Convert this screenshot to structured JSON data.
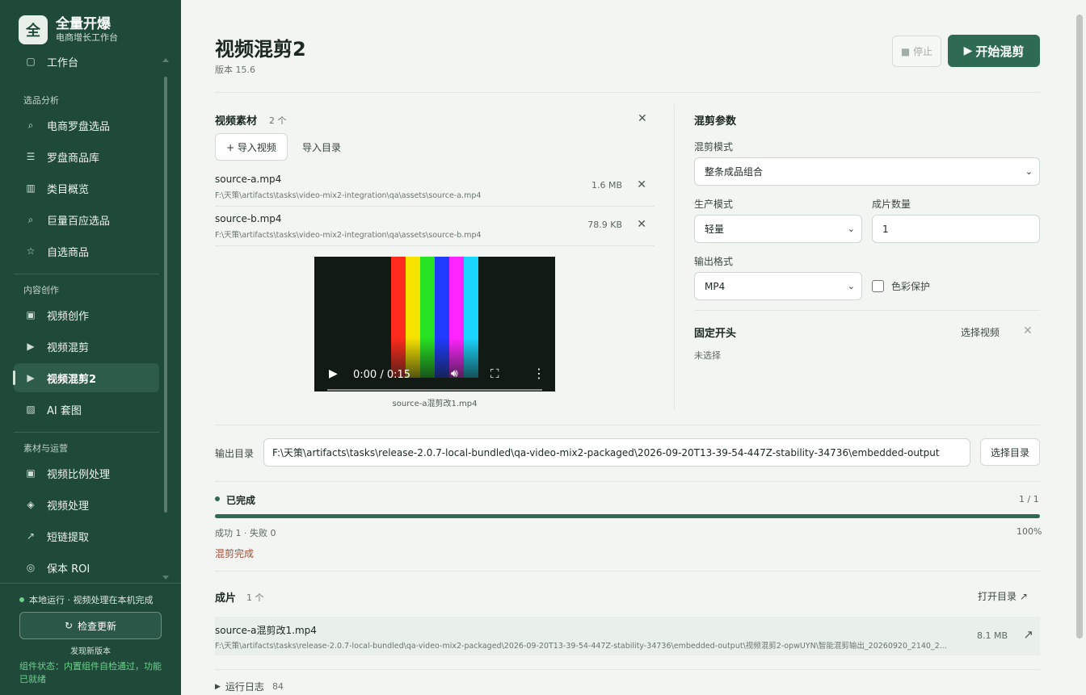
{
  "sidebar": {
    "brand": {
      "logo": "全",
      "title": "全量开爆",
      "subtitle": "电商增长工作台"
    },
    "items": [
      {
        "label": "工作台",
        "icon": "home-icon"
      },
      {
        "section": "选品分析"
      },
      {
        "label": "电商罗盘选品",
        "icon": "search-icon"
      },
      {
        "label": "罗盘商品库",
        "icon": "list-icon"
      },
      {
        "label": "类目概览",
        "icon": "grid-icon"
      },
      {
        "label": "巨量百应选品",
        "icon": "search-icon"
      },
      {
        "label": "自选商品",
        "icon": "star-icon"
      },
      {
        "section": "内容创作"
      },
      {
        "label": "视频创作",
        "icon": "video-box-icon"
      },
      {
        "label": "视频混剪",
        "icon": "play-icon"
      },
      {
        "label": "视频混剪2",
        "icon": "play-icon",
        "active": true
      },
      {
        "label": "AI 套图",
        "icon": "hatch-icon"
      },
      {
        "section": "素材与运营"
      },
      {
        "label": "视频比例处理",
        "icon": "video-box-icon"
      },
      {
        "label": "视频处理",
        "icon": "diamond-icon"
      },
      {
        "label": "短链提取",
        "icon": "arrow-link-icon"
      },
      {
        "label": "保本 ROI",
        "icon": "target-icon"
      }
    ],
    "sections": {
      "analysis": "选品分析",
      "content": "内容创作",
      "ops": "素材与运营"
    },
    "status": "本地运行 · 视频处理在本机完成",
    "update_button": "检查更新",
    "new_version": "发现新版本",
    "component_status": "组件状态：内置组件自检通过，功能已就绪"
  },
  "header": {
    "title": "视频混剪2",
    "version": "版本 15.6",
    "stop_label": "■ 停止",
    "start_label": "开始混剪"
  },
  "materials": {
    "title": "视频素材",
    "count": "2 个",
    "import_video": "+ 导入视频",
    "import_dir": "导入目录",
    "files": [
      {
        "name": "source-a.mp4",
        "path": "F:\\天策\\artifacts\\tasks\\video-mix2-integration\\qa\\assets\\source-a.mp4",
        "size": "1.6 MB"
      },
      {
        "name": "source-b.mp4",
        "path": "F:\\天策\\artifacts\\tasks\\video-mix2-integration\\qa\\assets\\source-b.mp4",
        "size": "78.9 KB"
      }
    ],
    "preview": {
      "time": "0:00 / 0:15",
      "caption": "source-a混剪改1.mp4",
      "bar_colors": [
        "#ff2b1c",
        "#f7e300",
        "#27e322",
        "#1f3cff",
        "#ff24ff",
        "#1ad6ff"
      ]
    }
  },
  "params": {
    "title": "混剪参数",
    "mode_label": "混剪模式",
    "mode_value": "整条成品组合",
    "production_label": "生产模式",
    "production_value": "轻量",
    "quantity_label": "成片数量",
    "quantity_value": "1",
    "format_label": "输出格式",
    "format_value": "MP4",
    "color_protect": "色彩保护",
    "fixed_intro_title": "固定开头",
    "fixed_intro_select": "选择视频",
    "fixed_intro_status": "未选择"
  },
  "output": {
    "label": "输出目录",
    "path": "F:\\天策\\artifacts\\tasks\\release-2.0.7-local-bundled\\qa-video-mix2-packaged\\2026-09-20T13-39-54-447Z-stability-34736\\embedded-output",
    "choose": "选择目录"
  },
  "progress": {
    "status": "已完成",
    "fraction": "1 / 1",
    "value": 1.0,
    "summary": "成功 1 · 失败 0",
    "percent": "100%",
    "message": "混剪完成"
  },
  "results": {
    "title": "成片",
    "count": "1 个",
    "open_dir": "打开目录 ↗",
    "items": [
      {
        "name": "source-a混剪改1.mp4",
        "path": "F:\\天策\\artifacts\\tasks\\release-2.0.7-local-bundled\\qa-video-mix2-packaged\\2026-09-20T13-39-54-447Z-stability-34736\\embedded-output\\视频混剪2-opwUYN\\智能混剪输出_20260920_2140_2...",
        "size": "8.1 MB"
      }
    ]
  },
  "log": {
    "label": "运行日志",
    "count": "84"
  },
  "colors": {
    "sidebar_bg": "#1f4a3a",
    "accent": "#2f6b52",
    "status_green": "#6fd08c"
  }
}
